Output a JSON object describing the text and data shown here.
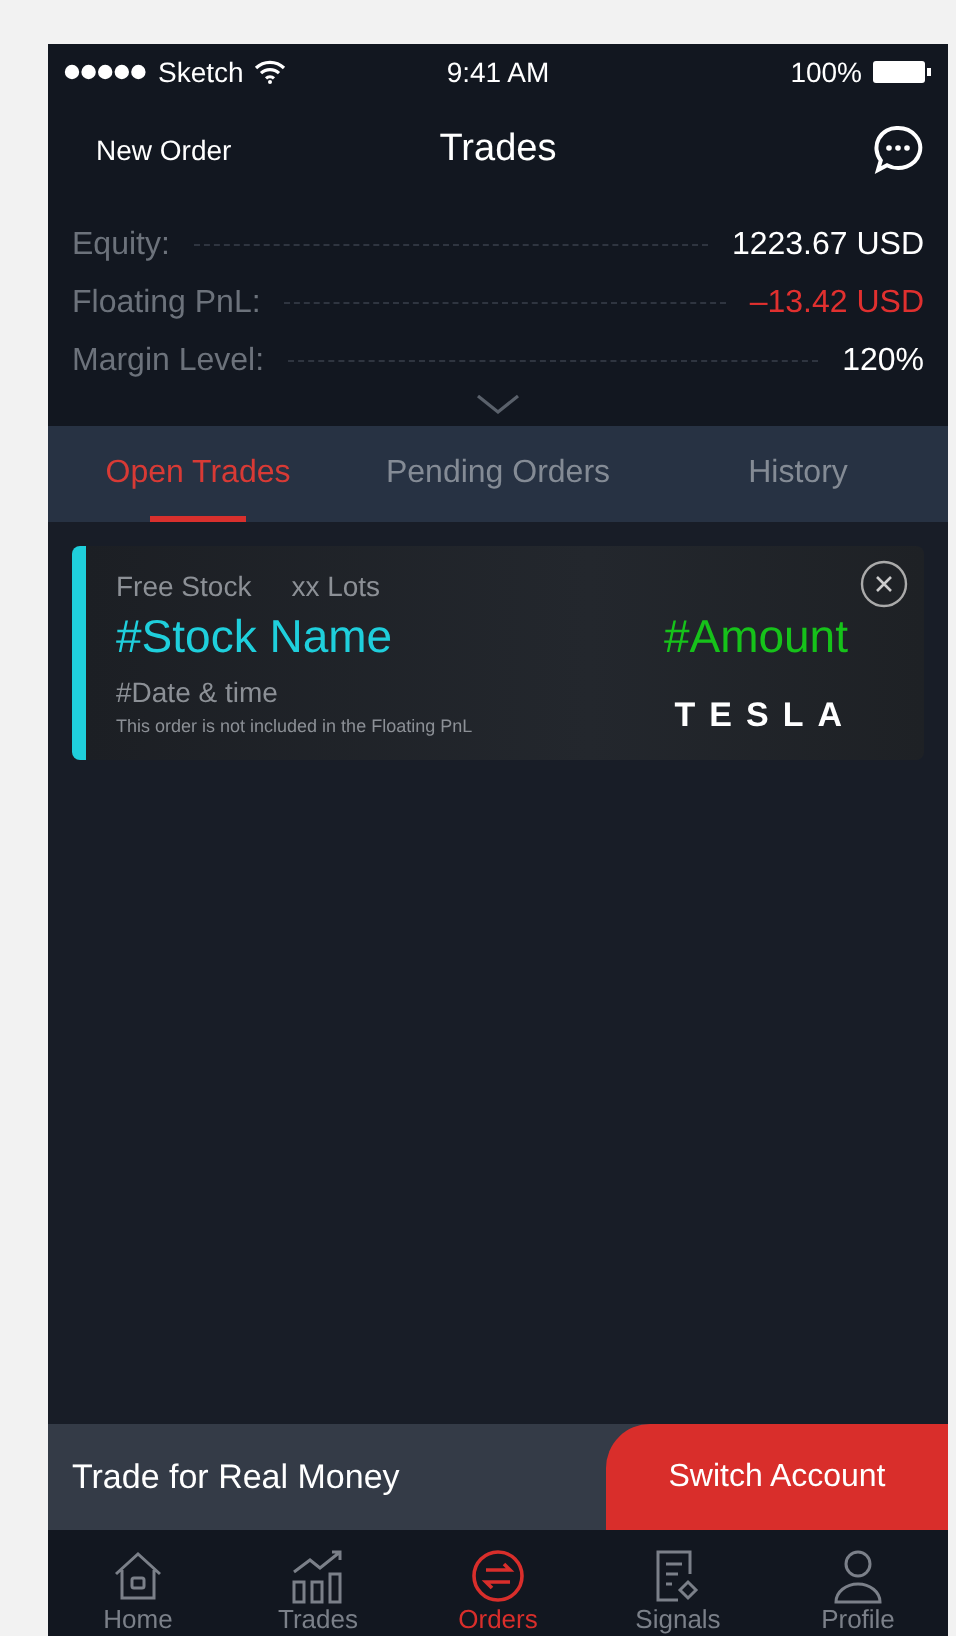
{
  "status_bar": {
    "carrier": "Sketch",
    "time": "9:41 AM",
    "battery": "100%"
  },
  "header": {
    "left_action": "New Order",
    "title": "Trades"
  },
  "metrics": [
    {
      "label": "Equity:",
      "value": "1223.67 USD",
      "negative": false
    },
    {
      "label": "Floating PnL:",
      "value": "–13.42 USD",
      "negative": true
    },
    {
      "label": "Margin Level:",
      "value": "120%",
      "negative": false
    }
  ],
  "tabs": [
    {
      "label": "Open Trades",
      "selected": true
    },
    {
      "label": "Pending Orders",
      "selected": false
    },
    {
      "label": "History",
      "selected": false
    }
  ],
  "trades": [
    {
      "type": "Free Stock",
      "lots": "xx Lots",
      "name": "#Stock Name",
      "amount": "#Amount",
      "date": "#Date & time",
      "note": "This order is not included in the Floating PnL",
      "logo": "TESLA"
    }
  ],
  "banner": {
    "text": "Trade for Real Money",
    "button": "Switch Account"
  },
  "nav": [
    {
      "label": "Home",
      "kind": "home",
      "selected": false
    },
    {
      "label": "Trades",
      "kind": "chart",
      "selected": false
    },
    {
      "label": "Orders",
      "kind": "orders",
      "selected": true
    },
    {
      "label": "Signals",
      "kind": "signals",
      "selected": false
    },
    {
      "label": "Profile",
      "kind": "profile",
      "selected": false
    }
  ]
}
